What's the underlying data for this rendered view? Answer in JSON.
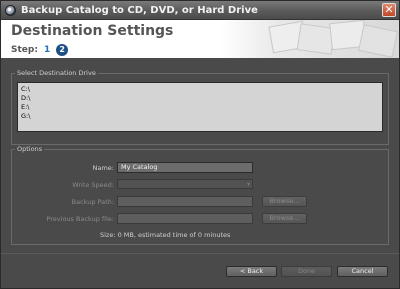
{
  "window": {
    "title": "Backup Catalog to CD, DVD, or Hard Drive",
    "close_glyph": "✕"
  },
  "header": {
    "title": "Destination Settings",
    "step_label": "Step:",
    "steps": [
      "1",
      "2"
    ],
    "current_step": "2"
  },
  "drive_group": {
    "legend": "Select Destination Drive",
    "drives": [
      "C:\\",
      "D:\\",
      "E:\\",
      "G:\\"
    ]
  },
  "options": {
    "legend": "Options",
    "name_label": "Name:",
    "name_value": "My Catalog",
    "write_speed_label": "Write Speed:",
    "write_speed_value": "",
    "backup_path_label": "Backup Path:",
    "backup_path_value": "",
    "previous_backup_label": "Previous Backup file:",
    "previous_backup_value": "",
    "browse_label": "Browse...",
    "size_text": "Size:  0 MB, estimated time of 0 minutes"
  },
  "footer": {
    "back_label": "< Back",
    "done_label": "Done",
    "cancel_label": "Cancel"
  },
  "icons": {
    "app": "app-disc-icon",
    "close": "close-icon",
    "dropdown": "chevron-down-icon"
  }
}
